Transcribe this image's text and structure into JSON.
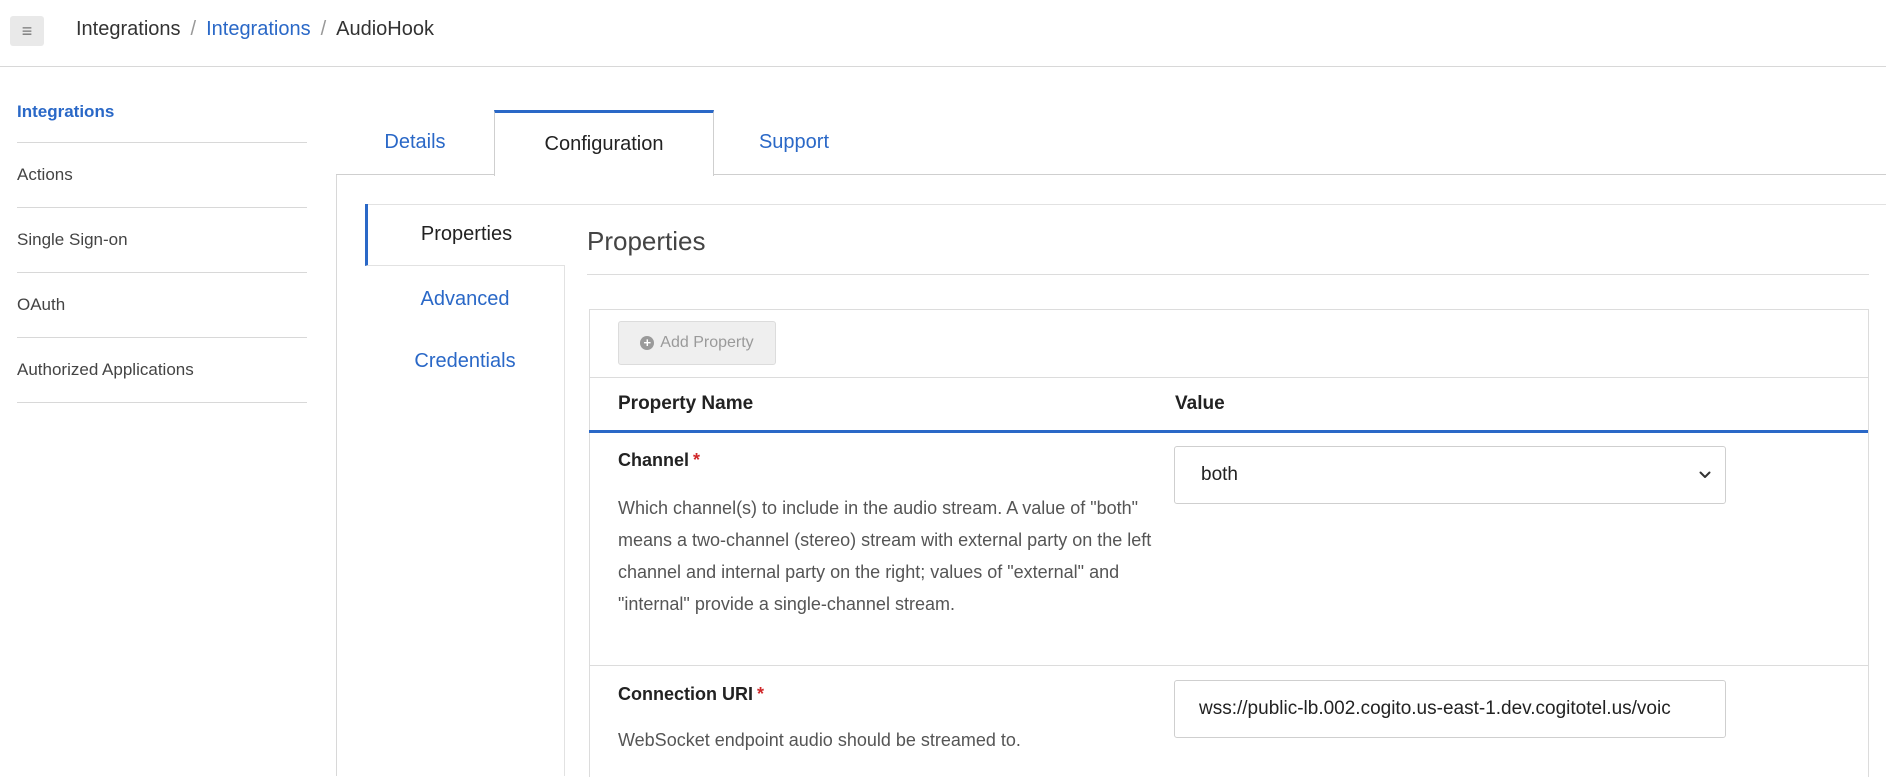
{
  "breadcrumb": {
    "items": [
      "Integrations",
      "Integrations",
      "AudioHook"
    ],
    "separator": "/"
  },
  "sidebar": {
    "items": [
      {
        "label": "Integrations",
        "active": true
      },
      {
        "label": "Actions"
      },
      {
        "label": "Single Sign-on"
      },
      {
        "label": "OAuth"
      },
      {
        "label": "Authorized Applications"
      }
    ]
  },
  "tabs": {
    "items": [
      {
        "label": "Details"
      },
      {
        "label": "Configuration",
        "active": true
      },
      {
        "label": "Support"
      }
    ]
  },
  "subnav": {
    "items": [
      {
        "label": "Properties",
        "active": true
      },
      {
        "label": "Advanced"
      },
      {
        "label": "Credentials"
      }
    ]
  },
  "properties": {
    "title": "Properties",
    "add_button": "Add Property",
    "columns": {
      "name": "Property Name",
      "value": "Value"
    },
    "rows": [
      {
        "name": "Channel",
        "required_mark": "*",
        "description": "Which channel(s) to include in the audio stream. A value of \"both\" means a two-channel (stereo) stream with external party on the left channel and internal party on the right; values of \"external\" and \"internal\" provide a single-channel stream.",
        "value": "both"
      },
      {
        "name": "Connection URI",
        "required_mark": "*",
        "description": "WebSocket endpoint audio should be streamed to.",
        "value": "wss://public-lb.002.cogito.us-east-1.dev.cogitotel.us/voic"
      }
    ]
  },
  "colors": {
    "accent": "#2a68c7",
    "required": "#d0282a"
  },
  "icons": {
    "menu": "hamburger-icon",
    "add": "plus-circle-icon",
    "select": "chevron-down-icon"
  }
}
